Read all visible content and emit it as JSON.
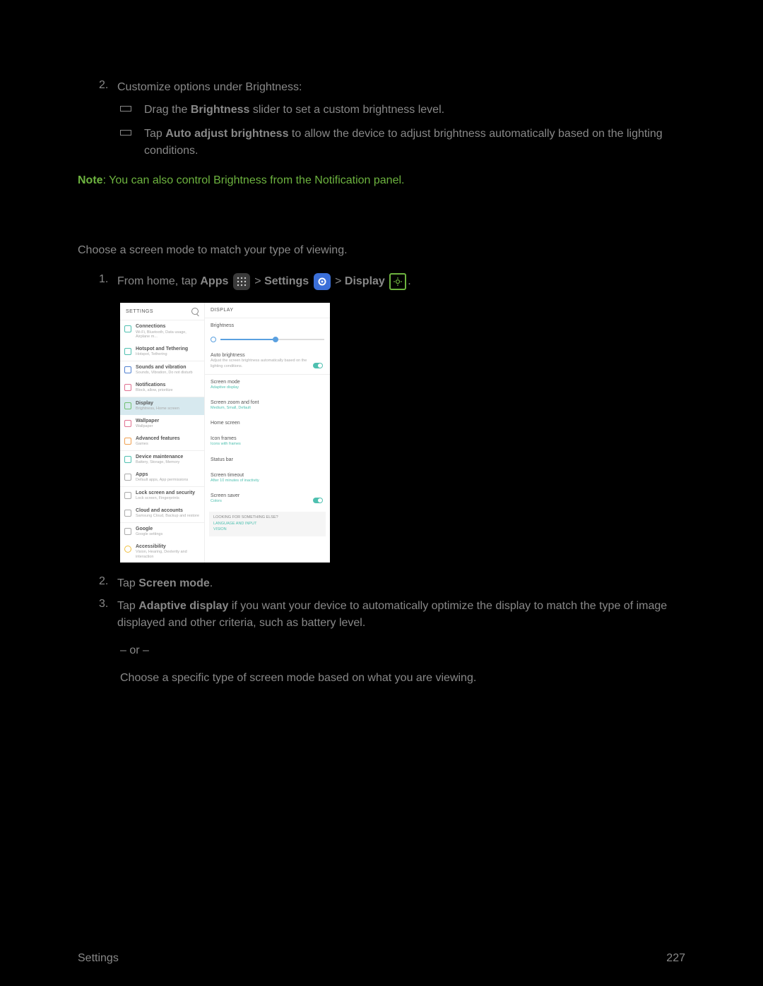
{
  "step2_num": "2.",
  "step2_text": "Customize options under Brightness:",
  "bullet1_a": "Drag the ",
  "bullet1_b": "Brightness",
  "bullet1_c": " slider to set a custom brightness level.",
  "bullet2_a": "Tap ",
  "bullet2_b": "Auto adjust brightness",
  "bullet2_c": " to allow the device to adjust brightness automatically based on the lighting conditions.",
  "note_label": "Note",
  "note_text": ": You can also control Brightness from the Notification panel.",
  "intro": "Choose a screen mode to match your type of viewing.",
  "s1_num": "1.",
  "s1_a": "From home, tap ",
  "s1_b": "Apps",
  "s1_c": " > ",
  "s1_d": "Settings",
  "s1_e": " > ",
  "s1_f": "Display",
  "s1_g": ".",
  "ss": {
    "left_head": "SETTINGS",
    "right_head": "DISPLAY",
    "left": [
      {
        "t": "Connections",
        "s": "Wi-Fi, Bluetooth, Data usage, Airplane m..."
      },
      {
        "t": "Hotspot and Tethering",
        "s": "Hotspot, Tethering"
      },
      {
        "t": "Sounds and vibration",
        "s": "Sounds, Vibration, Do not disturb"
      },
      {
        "t": "Notifications",
        "s": "Block, allow, prioritize"
      },
      {
        "t": "Display",
        "s": "Brightness, Home screen"
      },
      {
        "t": "Wallpaper",
        "s": "Wallpaper"
      },
      {
        "t": "Advanced features",
        "s": "Games"
      },
      {
        "t": "Device maintenance",
        "s": "Battery, Storage, Memory"
      },
      {
        "t": "Apps",
        "s": "Default apps, App permissions"
      },
      {
        "t": "Lock screen and security",
        "s": "Lock screen, Fingerprints"
      },
      {
        "t": "Cloud and accounts",
        "s": "Samsung Cloud, Backup and restore"
      },
      {
        "t": "Google",
        "s": "Google settings"
      },
      {
        "t": "Accessibility",
        "s": "Vision, Hearing, Dexterity and interaction"
      }
    ],
    "right": {
      "brightness": "Brightness",
      "auto_t": "Auto brightness",
      "auto_s": "Adjust the screen brightness automatically based on the lighting conditions.",
      "mode_t": "Screen mode",
      "mode_s": "Adaptive display",
      "zoom_t": "Screen zoom and font",
      "zoom_s": "Medium, Small, Default",
      "home": "Home screen",
      "icon_t": "Icon frames",
      "icon_s": "Icons with frames",
      "status": "Status bar",
      "timeout_t": "Screen timeout",
      "timeout_s": "After 10 minutes of inactivity",
      "saver_t": "Screen saver",
      "saver_s": "Colors",
      "look_h": "LOOKING FOR SOMETHING ELSE?",
      "look_1": "LANGUAGE AND INPUT",
      "look_2": "VISION"
    }
  },
  "s2_num": "2.",
  "s2_a": "Tap ",
  "s2_b": "Screen mode",
  "s2_c": ".",
  "s3_num": "3.",
  "s3_a": "Tap ",
  "s3_b": "Adaptive display",
  "s3_c": " if you want your device to automatically optimize the display to match the type of image displayed and other criteria, such as battery level.",
  "or": "‒ or ‒",
  "final": "Choose a specific type of screen mode based on what you are viewing.",
  "footer_left": "Settings",
  "footer_right": "227"
}
